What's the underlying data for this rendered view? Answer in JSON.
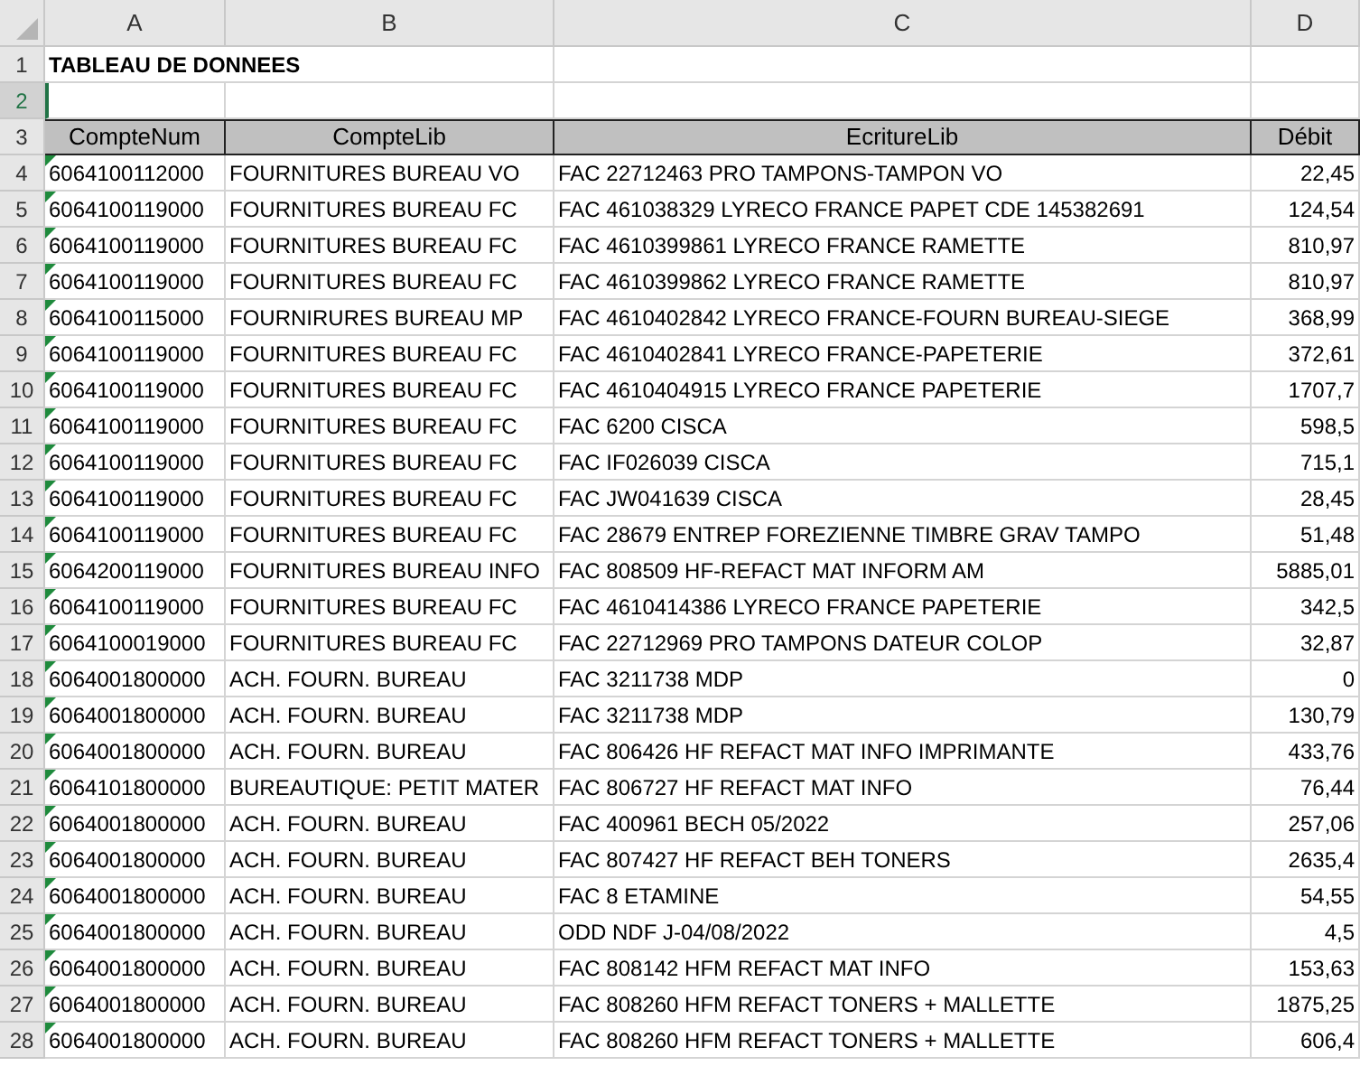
{
  "columns": [
    "A",
    "B",
    "C",
    "D"
  ],
  "rows": [
    {
      "number": "1",
      "selected": false,
      "kind": "title",
      "text": "TABLEAU DE DONNEES"
    },
    {
      "number": "2",
      "selected": true,
      "kind": "blank"
    },
    {
      "number": "3",
      "selected": false,
      "kind": "header",
      "cells": [
        "CompteNum",
        "CompteLib",
        "EcritureLib",
        "Débit"
      ]
    },
    {
      "number": "4",
      "selected": false,
      "kind": "data",
      "flagged": true,
      "cells": [
        "6064100112000",
        "FOURNITURES BUREAU VO",
        "FAC 22712463 PRO TAMPONS-TAMPON VO",
        "22,45"
      ]
    },
    {
      "number": "5",
      "selected": false,
      "kind": "data",
      "flagged": true,
      "cells": [
        "6064100119000",
        "FOURNITURES BUREAU FC",
        "FAC 461038329 LYRECO FRANCE PAPET CDE 145382691",
        "124,54"
      ]
    },
    {
      "number": "6",
      "selected": false,
      "kind": "data",
      "flagged": true,
      "cells": [
        "6064100119000",
        "FOURNITURES BUREAU FC",
        "FAC 4610399861 LYRECO FRANCE RAMETTE",
        "810,97"
      ]
    },
    {
      "number": "7",
      "selected": false,
      "kind": "data",
      "flagged": true,
      "cells": [
        "6064100119000",
        "FOURNITURES BUREAU FC",
        "FAC 4610399862 LYRECO FRANCE RAMETTE",
        "810,97"
      ]
    },
    {
      "number": "8",
      "selected": false,
      "kind": "data",
      "flagged": true,
      "cells": [
        "6064100115000",
        "FOURNIRURES BUREAU MP",
        "FAC 4610402842 LYRECO FRANCE-FOURN BUREAU-SIEGE",
        "368,99"
      ]
    },
    {
      "number": "9",
      "selected": false,
      "kind": "data",
      "flagged": true,
      "cells": [
        "6064100119000",
        "FOURNITURES BUREAU FC",
        "FAC 4610402841 LYRECO FRANCE-PAPETERIE",
        "372,61"
      ]
    },
    {
      "number": "10",
      "selected": false,
      "kind": "data",
      "flagged": true,
      "cells": [
        "6064100119000",
        "FOURNITURES BUREAU FC",
        "FAC 4610404915 LYRECO FRANCE PAPETERIE",
        "1707,7"
      ]
    },
    {
      "number": "11",
      "selected": false,
      "kind": "data",
      "flagged": true,
      "cells": [
        "6064100119000",
        "FOURNITURES BUREAU FC",
        "FAC 6200 CISCA",
        "598,5"
      ]
    },
    {
      "number": "12",
      "selected": false,
      "kind": "data",
      "flagged": true,
      "cells": [
        "6064100119000",
        "FOURNITURES BUREAU FC",
        "FAC IF026039 CISCA",
        "715,1"
      ]
    },
    {
      "number": "13",
      "selected": false,
      "kind": "data",
      "flagged": true,
      "cells": [
        "6064100119000",
        "FOURNITURES BUREAU FC",
        "FAC JW041639 CISCA",
        "28,45"
      ]
    },
    {
      "number": "14",
      "selected": false,
      "kind": "data",
      "flagged": true,
      "cells": [
        "6064100119000",
        "FOURNITURES BUREAU FC",
        "FAC 28679 ENTREP FOREZIENNE TIMBRE GRAV TAMPO",
        "51,48"
      ]
    },
    {
      "number": "15",
      "selected": false,
      "kind": "data",
      "flagged": true,
      "cells": [
        "6064200119000",
        "FOURNITURES BUREAU INFO",
        "FAC 808509 HF-REFACT MAT INFORM AM",
        "5885,01"
      ]
    },
    {
      "number": "16",
      "selected": false,
      "kind": "data",
      "flagged": true,
      "cells": [
        "6064100119000",
        "FOURNITURES BUREAU FC",
        "FAC 4610414386 LYRECO FRANCE PAPETERIE",
        "342,5"
      ]
    },
    {
      "number": "17",
      "selected": false,
      "kind": "data",
      "flagged": true,
      "cells": [
        "6064100019000",
        "FOURNITURES BUREAU FC",
        "FAC 22712969 PRO TAMPONS DATEUR COLOP",
        "32,87"
      ]
    },
    {
      "number": "18",
      "selected": false,
      "kind": "data",
      "flagged": true,
      "cells": [
        "6064001800000",
        "ACH. FOURN. BUREAU",
        "FAC 3211738 MDP",
        "0"
      ]
    },
    {
      "number": "19",
      "selected": false,
      "kind": "data",
      "flagged": true,
      "cells": [
        "6064001800000",
        "ACH. FOURN. BUREAU",
        "FAC 3211738 MDP",
        "130,79"
      ]
    },
    {
      "number": "20",
      "selected": false,
      "kind": "data",
      "flagged": true,
      "cells": [
        "6064001800000",
        "ACH. FOURN. BUREAU",
        "FAC 806426 HF REFACT MAT INFO IMPRIMANTE",
        "433,76"
      ]
    },
    {
      "number": "21",
      "selected": false,
      "kind": "data",
      "flagged": true,
      "cells": [
        "6064101800000",
        "BUREAUTIQUE: PETIT MATER",
        "FAC 806727 HF REFACT MAT INFO",
        "76,44"
      ]
    },
    {
      "number": "22",
      "selected": false,
      "kind": "data",
      "flagged": true,
      "cells": [
        "6064001800000",
        "ACH. FOURN. BUREAU",
        "FAC 400961 BECH 05/2022",
        "257,06"
      ]
    },
    {
      "number": "23",
      "selected": false,
      "kind": "data",
      "flagged": true,
      "cells": [
        "6064001800000",
        "ACH. FOURN. BUREAU",
        "FAC 807427 HF REFACT BEH TONERS",
        "2635,4"
      ]
    },
    {
      "number": "24",
      "selected": false,
      "kind": "data",
      "flagged": true,
      "cells": [
        "6064001800000",
        "ACH. FOURN. BUREAU",
        "FAC 8 ETAMINE",
        "54,55"
      ]
    },
    {
      "number": "25",
      "selected": false,
      "kind": "data",
      "flagged": true,
      "cells": [
        "6064001800000",
        "ACH. FOURN. BUREAU",
        "ODD NDF J-04/08/2022",
        "4,5"
      ]
    },
    {
      "number": "26",
      "selected": false,
      "kind": "data",
      "flagged": true,
      "cells": [
        "6064001800000",
        "ACH. FOURN. BUREAU",
        "FAC 808142 HFM REFACT MAT INFO",
        "153,63"
      ]
    },
    {
      "number": "27",
      "selected": false,
      "kind": "data",
      "flagged": true,
      "cells": [
        "6064001800000",
        "ACH. FOURN. BUREAU",
        "FAC 808260 HFM REFACT TONERS + MALLETTE",
        "1875,25"
      ]
    },
    {
      "number": "28",
      "selected": false,
      "kind": "data",
      "flagged": true,
      "cells": [
        "6064001800000",
        "ACH. FOURN. BUREAU",
        "FAC 808260 HFM REFACT TONERS + MALLETTE",
        "606,4"
      ]
    }
  ]
}
